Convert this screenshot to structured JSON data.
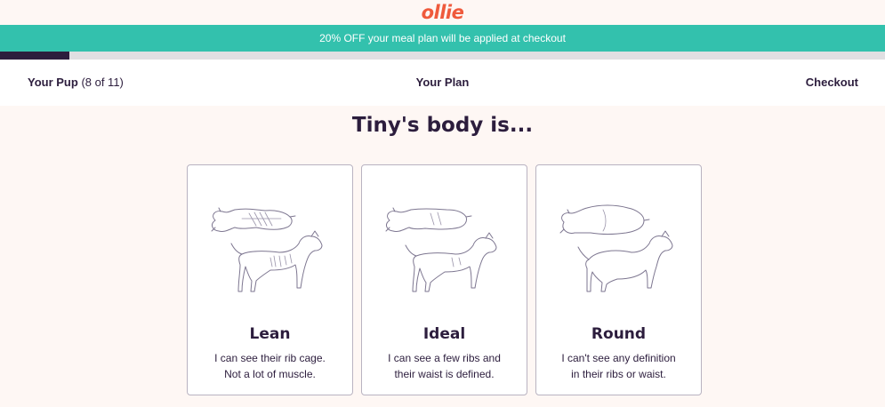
{
  "brand": {
    "logo": "ollie",
    "logo_color": "#ef5a3c"
  },
  "promo": {
    "text": "20% OFF your meal plan will be applied at checkout",
    "color": "#33c1ad"
  },
  "progress": {
    "current": 1,
    "total": 11,
    "fill_fraction": 0.078
  },
  "steps": {
    "pup_label": "Your Pup",
    "pup_count": "(8 of 11)",
    "plan_label": "Your Plan",
    "checkout_label": "Checkout"
  },
  "question": {
    "heading": "Tiny's body is..."
  },
  "options": [
    {
      "title": "Lean",
      "line1": "I can see their rib cage.",
      "line2": "Not a lot of muscle.",
      "icon": "lean-dog-illustration"
    },
    {
      "title": "Ideal",
      "line1": "I can see a few ribs and",
      "line2": "their waist is defined.",
      "icon": "ideal-dog-illustration"
    },
    {
      "title": "Round",
      "line1": "I can't see any definition",
      "line2": "in their ribs or waist.",
      "icon": "round-dog-illustration"
    }
  ],
  "colors": {
    "ink": "#2c1d3d",
    "background": "#fef7f4",
    "card_border": "#b9b3c1"
  }
}
